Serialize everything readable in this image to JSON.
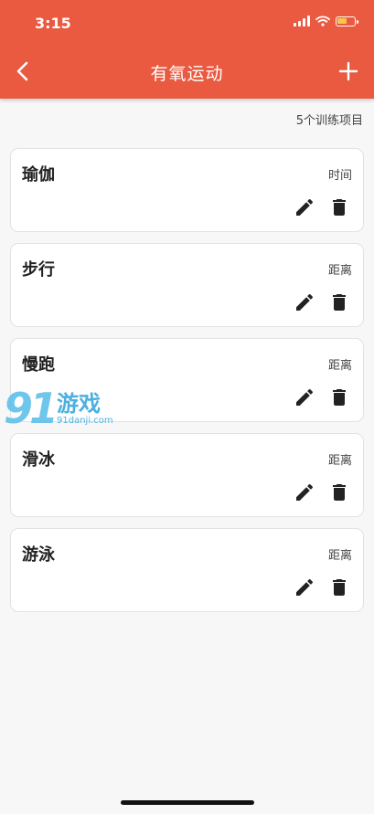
{
  "status_bar": {
    "time": "3:15"
  },
  "app_bar": {
    "title": "有氧运动"
  },
  "summary": {
    "count_text": "5个训练项目"
  },
  "items": [
    {
      "name": "瑜伽",
      "type": "时间"
    },
    {
      "name": "步行",
      "type": "距离"
    },
    {
      "name": "慢跑",
      "type": "距离"
    },
    {
      "name": "滑冰",
      "type": "距离"
    },
    {
      "name": "游泳",
      "type": "距离"
    }
  ],
  "watermark": {
    "mark": "91",
    "name": "游戏",
    "url": "91danji.com"
  },
  "colors": {
    "accent": "#e95a40",
    "background": "#f7f7f7",
    "battery": "#f7c64a"
  },
  "icons": [
    "back-arrow-icon",
    "add-icon",
    "edit-icon",
    "delete-icon",
    "wifi-icon",
    "signal-icon",
    "battery-icon"
  ]
}
